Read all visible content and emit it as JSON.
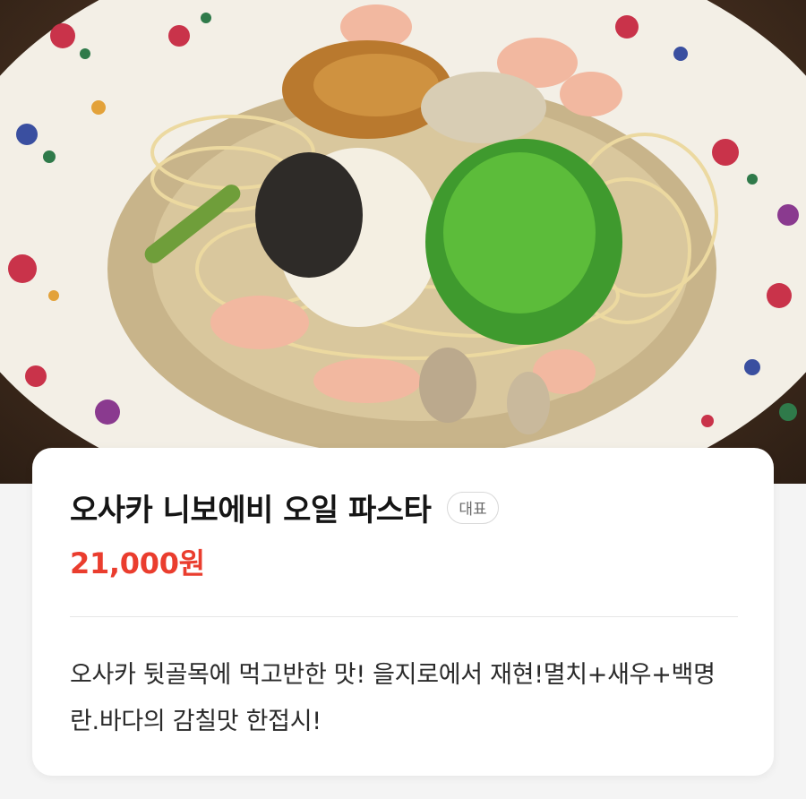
{
  "photo": {
    "subject": "osaka-niboebi-oil-pasta-photo"
  },
  "menu": {
    "name": "오사카 니보에비 오일 파스타",
    "badge": "대표",
    "price": "21,000원",
    "description": "오사카 뒷골목에 먹고반한 맛! 을지로에서 재현!멸치+새우+백명란.바다의 감칠맛 한접시!"
  },
  "colors": {
    "price": "#ea3d2e",
    "title": "#151515",
    "badge_border": "#d8d8d8"
  }
}
